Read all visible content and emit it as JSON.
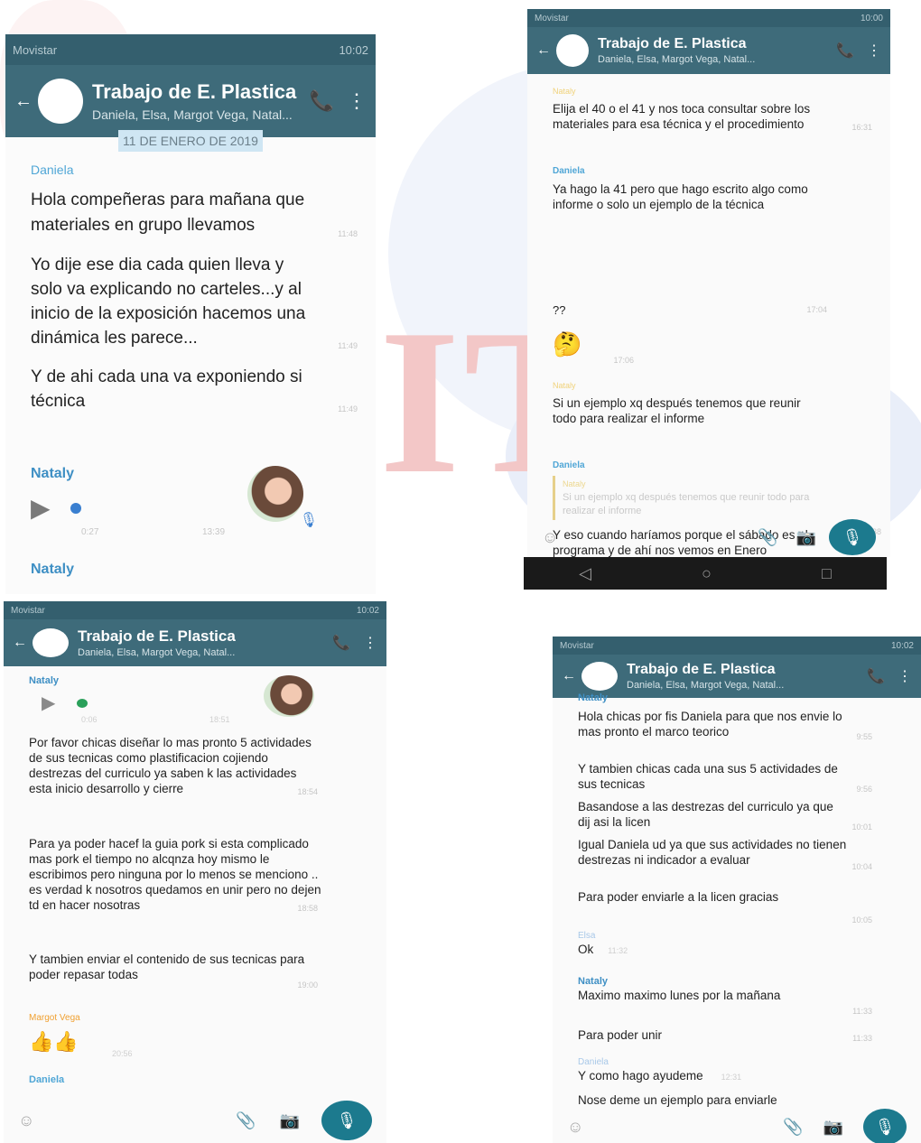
{
  "chat": {
    "title": "Trabajo de E. Plastica",
    "members": "Daniela, Elsa, Margot Vega, Natal..."
  },
  "panels": {
    "p1": {
      "carrier": "Movistar",
      "clock": "10:02",
      "date_chip": "11 DE ENERO DE 2019",
      "messages": [
        {
          "sender": "Daniela",
          "text": "Hola compeñeras  para mañana que materiales en grupo llevamos",
          "time": "11:48"
        },
        {
          "sender": "",
          "text": "Yo dije ese dia cada quien lleva y solo va explicando no carteles...y al inicio de la exposición hacemos una dinámica les parece...",
          "time": "11:49"
        },
        {
          "sender": "",
          "text": "Y de ahi cada una va exponiendo si técnica",
          "time": "11:49"
        }
      ],
      "voice": {
        "sender": "Nataly",
        "duration": "0:27",
        "time": "13:39"
      },
      "last_sender": "Nataly"
    },
    "p2": {
      "carrier": "Movistar",
      "clock": "10:00",
      "messages": [
        {
          "sender": "Nataly",
          "text": "Elija el 40 o el 41 y nos toca consultar sobre los materiales para esa técnica y el procedimiento",
          "time": "16:31"
        },
        {
          "sender": "Daniela",
          "text": "Ya hago la 41 pero que hago escrito algo como informe o solo un ejemplo de la técnica",
          "time": ""
        },
        {
          "sender": "",
          "text": "??",
          "time": "17:04"
        },
        {
          "sender": "",
          "text": "🤔",
          "time": "17:06"
        },
        {
          "sender": "Nataly",
          "text": "Si  un ejemplo xq después tenemos que  reunir todo para realizar el informe",
          "time": ""
        },
        {
          "sender": "Daniela",
          "text": "Y eso cuando haríamos porque el sábado es el programa y de ahí nos vemos en Enero",
          "time": "20:38"
        }
      ],
      "quote": {
        "sender": "Nataly",
        "text": "Si  un ejemplo xq después tenemos que reunir todo para realizar el informe"
      }
    },
    "p3": {
      "carrier": "Movistar",
      "clock": "10:02",
      "voice": {
        "sender": "Nataly",
        "duration": "0:06",
        "time": "18:51"
      },
      "messages": [
        {
          "sender": "",
          "text": "Por favor chicas diseñar lo mas pronto 5 actividades de sus tecnicas como plastificacion cojiendo destrezas del curriculo ya saben k las actividades esta inicio desarrollo y cierre",
          "time": "18:54"
        },
        {
          "sender": "",
          "text": "Para ya poder hacef la guia pork si esta complicado mas pork el tiempo no alcqnza hoy mismo le escribimos pero ninguna por lo menos se menciono .. es verdad k nosotros quedamos en unir pero no dejen td en hacer nosotras",
          "time": "18:58"
        },
        {
          "sender": "",
          "text": "Y tambien enviar el contenido de sus tecnicas para poder repasar todas",
          "time": "19:00"
        },
        {
          "sender": "Margot Vega",
          "text": "👍👍",
          "time": "20:56"
        }
      ],
      "last_sender": "Daniela"
    },
    "p4": {
      "carrier": "Movistar",
      "clock": "10:02",
      "first_sender": "Nataly",
      "messages": [
        {
          "sender": "",
          "text": "Hola chicas por fis Daniela para que nos envie lo mas pronto el marco teorico",
          "time": "9:55"
        },
        {
          "sender": "",
          "text": "Y tambien chicas cada una  sus 5 actividades de sus tecnicas",
          "time": "9:56"
        },
        {
          "sender": "",
          "text": "Basandose a las destrezas del curriculo ya que dij asi la licen",
          "time": "10:01"
        },
        {
          "sender": "",
          "text": "Igual Daniela ud ya que sus actividades no tienen destrezas ni indicador a evaluar",
          "time": "10:04"
        },
        {
          "sender": "",
          "text": "Para poder enviarle a la licen gracias",
          "time": "10:05"
        },
        {
          "sender": "Elsa",
          "text": "Ok",
          "time": "11:32"
        },
        {
          "sender": "Nataly",
          "text": "Maximo maximo lunes por la mañana",
          "time": "11:33"
        },
        {
          "sender": "",
          "text": "Para poder unir",
          "time": "11:33"
        },
        {
          "sender": "Daniela",
          "text": "Y como hago ayudeme",
          "time": "12:31"
        },
        {
          "sender": "",
          "text": "Nose deme un ejemplo para enviarle",
          "time": ""
        }
      ]
    }
  },
  "watermark": "IT",
  "colors": {
    "appbar": "#3e6b7a",
    "statusbar": "#345f6e",
    "daniela": "#4fa6d6",
    "nataly": "#3e8fc4",
    "margot": "#f0a030",
    "mic": "#1c7a8e"
  },
  "icons": [
    "back-arrow-icon",
    "add-call-icon",
    "more-vert-icon",
    "emoji-icon",
    "attach-icon",
    "camera-icon",
    "mic-icon",
    "play-icon"
  ]
}
